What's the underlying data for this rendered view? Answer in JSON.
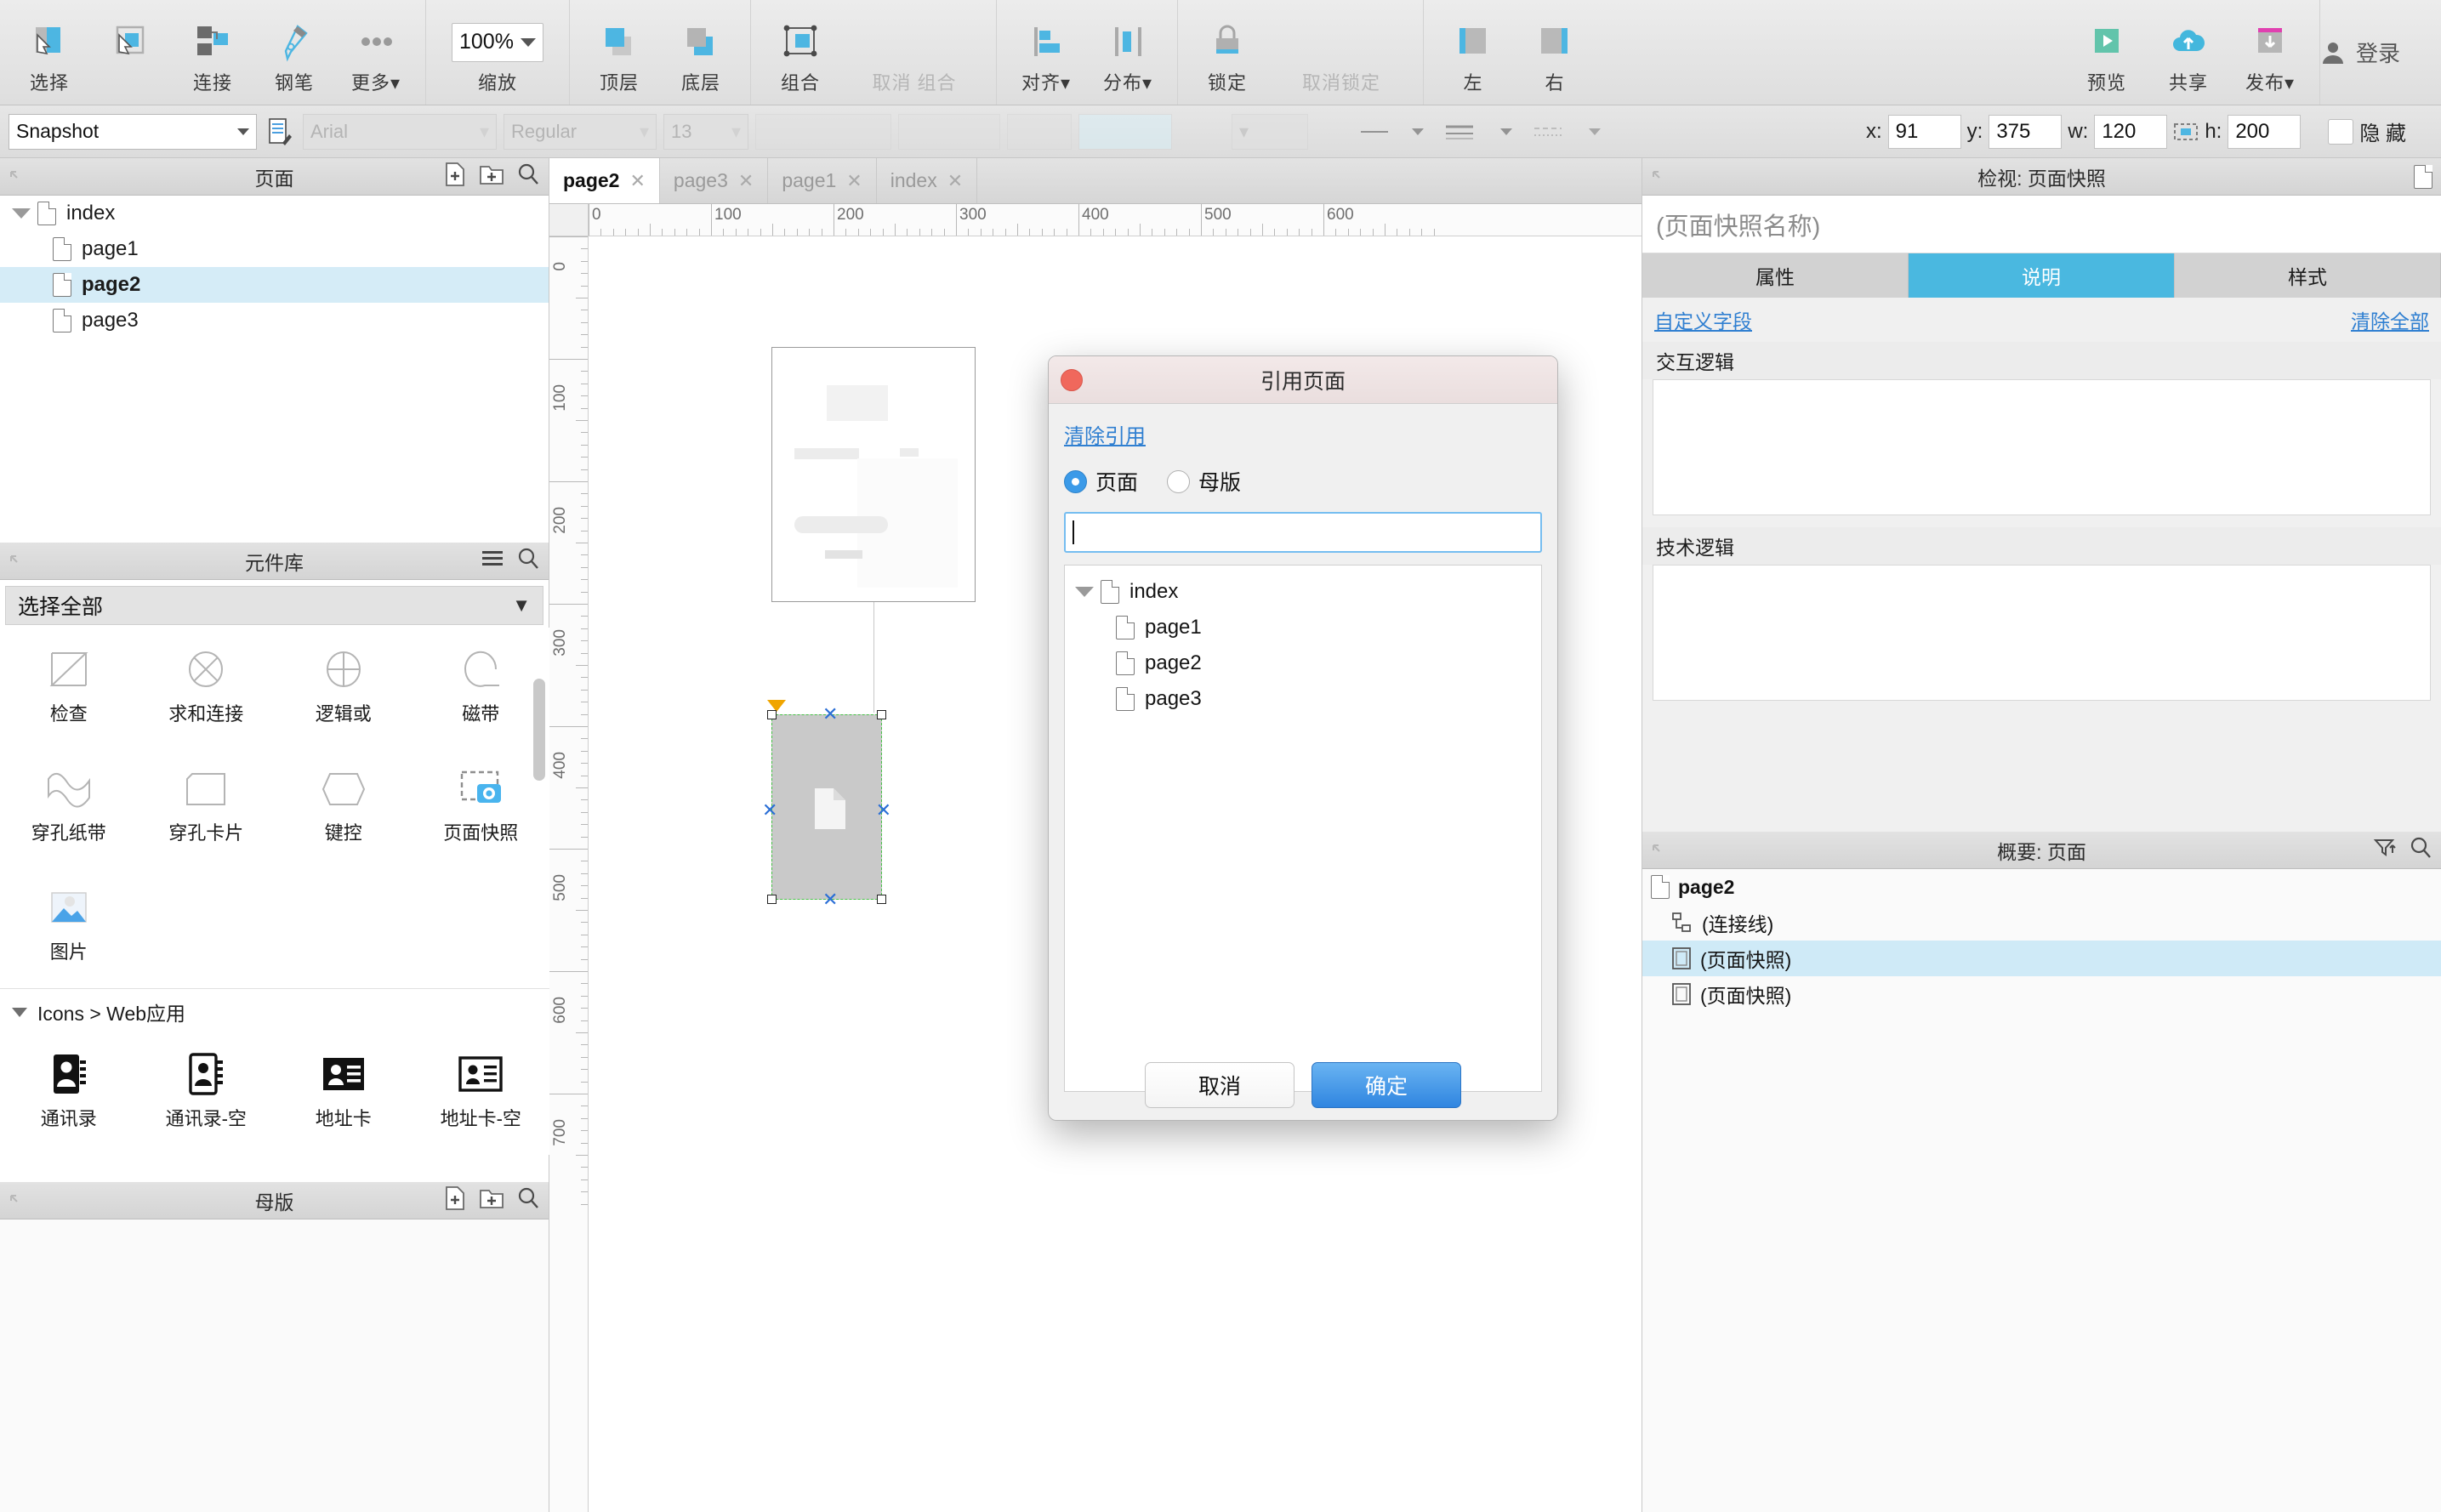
{
  "toolbar": {
    "groups": [
      {
        "items": [
          {
            "label": "选择",
            "icon": "select-icon"
          },
          {
            "label": "连接",
            "icon": "connect-icon"
          },
          {
            "label": "钢笔",
            "icon": "pen-icon"
          },
          {
            "label": "更多▾",
            "icon": "more-icon"
          }
        ]
      },
      {
        "items": [
          {
            "label": "缩放",
            "icon": "zoom-level",
            "value": "100%"
          }
        ]
      },
      {
        "items": [
          {
            "label": "顶层",
            "icon": "bring-front-icon"
          },
          {
            "label": "底层",
            "icon": "send-back-icon"
          }
        ]
      },
      {
        "items": [
          {
            "label": "组合",
            "icon": "group-icon"
          },
          {
            "label": "取消 组合",
            "icon": "ungroup-icon",
            "dim": true
          }
        ]
      },
      {
        "items": [
          {
            "label": "对齐▾",
            "icon": "align-icon"
          },
          {
            "label": "分布▾",
            "icon": "distribute-icon"
          }
        ]
      },
      {
        "items": [
          {
            "label": "锁定",
            "icon": "lock-icon"
          },
          {
            "label": "取消锁定",
            "icon": "unlock-icon",
            "dim": true
          }
        ]
      },
      {
        "items": [
          {
            "label": "左",
            "icon": "align-left-icon"
          },
          {
            "label": "右",
            "icon": "align-right-icon"
          }
        ]
      },
      {
        "items": [
          {
            "label": "预览",
            "icon": "preview-icon"
          },
          {
            "label": "共享",
            "icon": "share-cloud-icon"
          },
          {
            "label": "发布▾",
            "icon": "publish-icon"
          }
        ]
      }
    ],
    "login_label": "登录",
    "zoom_value": "100%",
    "zoom_label": "缩放"
  },
  "propbar": {
    "selection_name": "Snapshot",
    "font_family": "Arial",
    "font_weight": "Regular",
    "font_size": "13",
    "x_label": "x:",
    "x_value": "91",
    "y_label": "y:",
    "y_value": "375",
    "w_label": "w:",
    "w_value": "120",
    "h_label": "h:",
    "h_value": "200",
    "hidden_label": "隐 藏"
  },
  "pages_panel": {
    "title": "页面",
    "tools": [
      "add-page-icon",
      "add-folder-icon",
      "search-icon"
    ],
    "tree": [
      {
        "label": "index",
        "depth": 0,
        "expanded": true,
        "selected": false,
        "bold": false
      },
      {
        "label": "page1",
        "depth": 1,
        "expanded": false,
        "selected": false,
        "bold": false
      },
      {
        "label": "page2",
        "depth": 1,
        "expanded": false,
        "selected": true,
        "bold": true
      },
      {
        "label": "page3",
        "depth": 1,
        "expanded": false,
        "selected": false,
        "bold": false
      }
    ]
  },
  "library_panel": {
    "title": "元件库",
    "tools": [
      "menu-icon",
      "search-icon"
    ],
    "selector_value": "选择全部",
    "items_row1": [
      {
        "label": "检查",
        "icon": "hourglass-shape-icon"
      },
      {
        "label": "求和连接",
        "icon": "circle-cross-icon"
      },
      {
        "label": "逻辑或",
        "icon": "circle-plus-icon"
      },
      {
        "label": "磁带",
        "icon": "tape-icon"
      }
    ],
    "items_row2": [
      {
        "label": "穿孔纸带",
        "icon": "punched-tape-icon"
      },
      {
        "label": "穿孔卡片",
        "icon": "punched-card-icon"
      },
      {
        "label": "键控",
        "icon": "keying-icon"
      },
      {
        "label": "页面快照",
        "icon": "page-snapshot-icon"
      }
    ],
    "items_row3": [
      {
        "label": "图片",
        "icon": "image-icon"
      }
    ],
    "category_label": "Icons > Web应用",
    "items_row4": [
      {
        "label": "通讯录",
        "icon": "contacts-icon"
      },
      {
        "label": "通讯录-空",
        "icon": "contacts-outline-icon"
      },
      {
        "label": "地址卡",
        "icon": "address-card-icon"
      },
      {
        "label": "地址卡-空",
        "icon": "address-card-outline-icon"
      }
    ]
  },
  "masters_panel": {
    "title": "母版",
    "tools": [
      "add-master-icon",
      "add-folder-icon",
      "search-icon"
    ]
  },
  "canvas": {
    "tabs": [
      {
        "label": "page2",
        "active": true
      },
      {
        "label": "page3",
        "active": false
      },
      {
        "label": "page1",
        "active": false
      },
      {
        "label": "index",
        "active": false
      }
    ],
    "ruler_h_ticks": [
      "0",
      "100",
      "200",
      "300",
      "400",
      "500",
      "600"
    ],
    "ruler_v_ticks": [
      "0",
      "100",
      "200",
      "300",
      "400",
      "500",
      "600",
      "700"
    ]
  },
  "dialog": {
    "title": "引用页面",
    "clear_link": "清除引用",
    "radio_pages": "页面",
    "radio_masters": "母版",
    "radio_selected": "页面",
    "search_value": "",
    "tree": [
      {
        "label": "index",
        "depth": 0,
        "expanded": true
      },
      {
        "label": "page1",
        "depth": 1,
        "expanded": false
      },
      {
        "label": "page2",
        "depth": 1,
        "expanded": false
      },
      {
        "label": "page3",
        "depth": 1,
        "expanded": false
      }
    ],
    "cancel_label": "取消",
    "ok_label": "确定"
  },
  "inspector": {
    "title": "检视: 页面快照",
    "name_placeholder": "(页面快照名称)",
    "tabs": [
      {
        "label": "属性",
        "active": false
      },
      {
        "label": "说明",
        "active": true
      },
      {
        "label": "样式",
        "active": false
      }
    ],
    "custom_field_link": "自定义字段",
    "clear_all_link": "清除全部",
    "sections": [
      {
        "label": "交互逻辑",
        "value": ""
      },
      {
        "label": "技术逻辑",
        "value": ""
      }
    ]
  },
  "outline": {
    "title": "概要: 页面",
    "tools": [
      "filter-icon",
      "search-icon"
    ],
    "rows": [
      {
        "label": "page2",
        "icon": "page-icon",
        "head": true,
        "selected": false
      },
      {
        "label": "(连接线)",
        "icon": "connector-icon",
        "head": false,
        "selected": false
      },
      {
        "label": "(页面快照)",
        "icon": "snapshot-icon",
        "head": false,
        "selected": true
      },
      {
        "label": "(页面快照)",
        "icon": "snapshot-icon",
        "head": false,
        "selected": false
      }
    ]
  },
  "colors": {
    "accent_blue": "#4ab8e0",
    "link_blue": "#2f7fd1",
    "ok_button": "#2f85e0",
    "selection_green": "#46c246",
    "close_red": "#f0685c",
    "publish_magenta": "#e040b0"
  }
}
